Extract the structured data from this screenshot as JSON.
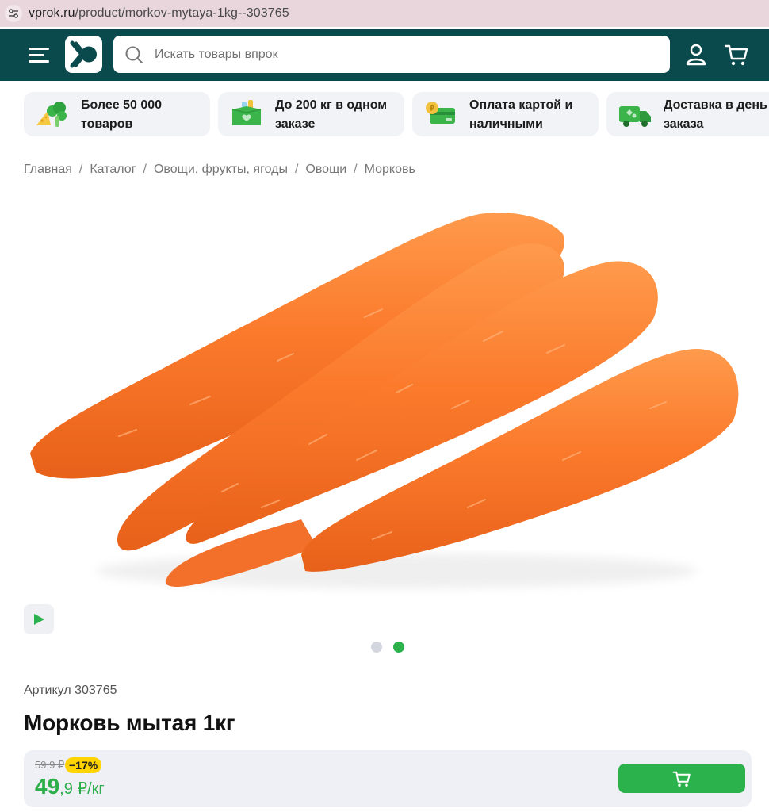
{
  "browser": {
    "url_host": "vprok.ru",
    "url_path": "/product/morkov-mytaya-1kg--303765"
  },
  "header": {
    "search_placeholder": "Искать товары впрок",
    "colors": {
      "header_bg": "#0b4a4c",
      "accent": "#2bb24c"
    }
  },
  "features": [
    {
      "line1": "Более 50 000",
      "line2": "товаров",
      "icon": "broccoli-cheese-icon"
    },
    {
      "line1": "До 200 кг в одном",
      "line2": "заказе",
      "icon": "grocery-box-icon"
    },
    {
      "line1": "Оплата картой и",
      "line2": "наличными",
      "icon": "card-coin-icon"
    },
    {
      "line1": "Доставка в день",
      "line2": "заказа",
      "icon": "delivery-truck-icon"
    }
  ],
  "breadcrumbs": [
    "Главная",
    "Каталог",
    "Овощи, фрукты, ягоды",
    "Овощи",
    "Морковь"
  ],
  "gallery": {
    "slides": 2,
    "active_slide": 2
  },
  "product": {
    "article": "Артикул 303765",
    "title": "Морковь мытая 1кг",
    "old_price": "59,9 ₽",
    "discount": "−17%",
    "price_int": "49",
    "price_frac": ",9 ₽/кг"
  }
}
